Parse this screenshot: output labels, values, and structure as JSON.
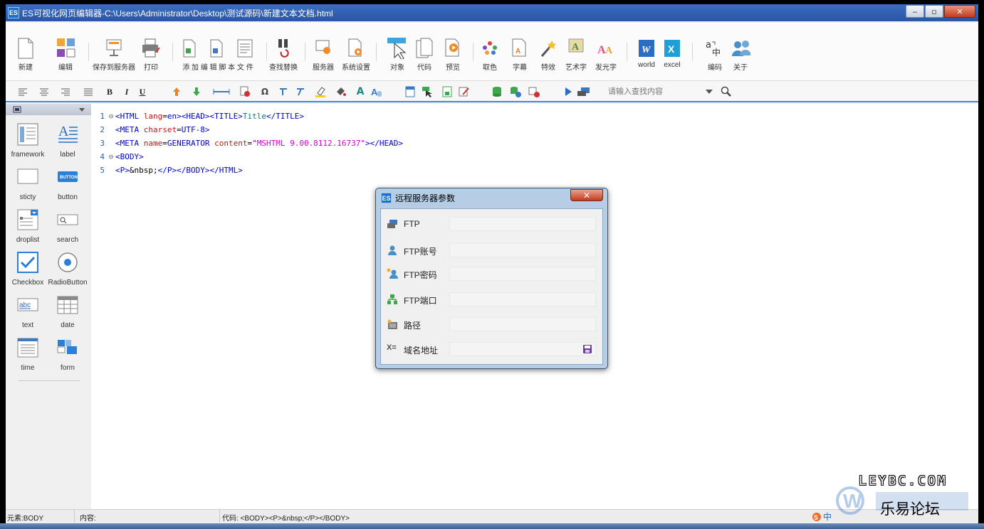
{
  "window": {
    "title": "ES可视化网页编辑器-C:\\Users\\Administrator\\Desktop\\测试源码\\新建文本文档.html",
    "app_badge": "ES",
    "minimize": "‒",
    "maximize": "▫",
    "close": "✕"
  },
  "toolbar": [
    {
      "label": "新建",
      "icon": "new-file-icon"
    },
    {
      "label": "编辑",
      "icon": "edit-icon"
    },
    {
      "label": "保存到服务器",
      "icon": "save-server-icon"
    },
    {
      "label": "打印",
      "icon": "printer-icon"
    },
    {
      "label": "添 加 编 辑 脚 本 文 件",
      "icon": "script-file-icon"
    },
    {
      "label": "查找替换",
      "icon": "find-replace-icon"
    },
    {
      "label": "服务器",
      "icon": "server-icon"
    },
    {
      "label": "系统设置",
      "icon": "settings-icon"
    },
    {
      "label": "对象",
      "icon": "object-cursor-icon"
    },
    {
      "label": "代码",
      "icon": "code-icon"
    },
    {
      "label": "预览",
      "icon": "preview-icon"
    },
    {
      "label": "取色",
      "icon": "color-picker-icon"
    },
    {
      "label": "字幕",
      "icon": "subtitle-icon"
    },
    {
      "label": "特效",
      "icon": "effect-wand-icon"
    },
    {
      "label": "艺术字",
      "icon": "art-text-icon"
    },
    {
      "label": "发光字",
      "icon": "glow-text-icon"
    },
    {
      "label": "world",
      "icon": "word-icon"
    },
    {
      "label": "excel",
      "icon": "excel-icon"
    },
    {
      "label": "编码",
      "icon": "encoding-icon"
    },
    {
      "label": "关于",
      "icon": "about-users-icon"
    }
  ],
  "format_toolbar": {
    "bold": "B",
    "italic": "I",
    "underline": "U",
    "omega": "Ω",
    "text_a": "A",
    "search_placeholder": "请输入查找内容"
  },
  "sidebar": {
    "components": [
      {
        "label": "framework",
        "icon": "framework-icon"
      },
      {
        "label": "label",
        "icon": "label-icon"
      },
      {
        "label": "sticty",
        "icon": "sticty-icon"
      },
      {
        "label": "button",
        "icon": "button-icon",
        "badge": "BUTTON"
      },
      {
        "label": "droplist",
        "icon": "droplist-icon"
      },
      {
        "label": "search",
        "icon": "search-box-icon"
      },
      {
        "label": "Checkbox",
        "icon": "checkbox-icon"
      },
      {
        "label": "RadioButton",
        "icon": "radio-button-icon"
      },
      {
        "label": "text",
        "icon": "text-field-icon",
        "badge": "abc"
      },
      {
        "label": "date",
        "icon": "date-grid-icon"
      },
      {
        "label": "time",
        "icon": "time-icon"
      },
      {
        "label": "form",
        "icon": "form-icon"
      }
    ]
  },
  "editor": {
    "lines": [
      {
        "num": "1",
        "fold": "⊖",
        "tokens": [
          [
            "tag",
            "<HTML "
          ],
          [
            "attr",
            "lang"
          ],
          [
            "plain",
            "="
          ],
          [
            "val",
            "en"
          ],
          [
            "tag",
            "><HEAD><TITLE>"
          ],
          [
            "txt",
            "Title"
          ],
          [
            "tag",
            "</TITLE>"
          ]
        ]
      },
      {
        "num": "2",
        "fold": "",
        "tokens": [
          [
            "tag",
            "<META "
          ],
          [
            "attr",
            "charset"
          ],
          [
            "plain",
            "="
          ],
          [
            "val",
            "UTF-8"
          ],
          [
            "tag",
            ">"
          ]
        ]
      },
      {
        "num": "3",
        "fold": "",
        "tokens": [
          [
            "tag",
            "<META "
          ],
          [
            "attr",
            "name"
          ],
          [
            "plain",
            "="
          ],
          [
            "val",
            "GENERATOR "
          ],
          [
            "attr",
            "content"
          ],
          [
            "plain",
            "="
          ],
          [
            "str",
            "\"MSHTML 9.00.8112.16737\""
          ],
          [
            "tag",
            "></HEAD>"
          ]
        ]
      },
      {
        "num": "4",
        "fold": "⊖",
        "tokens": [
          [
            "tag",
            "<BODY>"
          ]
        ]
      },
      {
        "num": "5",
        "fold": "",
        "tokens": [
          [
            "tag",
            "<P>"
          ],
          [
            "plain",
            "&nbsp;"
          ],
          [
            "tag",
            "</P></BODY></HTML>"
          ]
        ]
      }
    ]
  },
  "dialog": {
    "badge": "ES",
    "title": "远程服务器参数",
    "close": "✕",
    "fields": [
      {
        "label": "FTP",
        "icon": "ftp-server-icon",
        "value": ""
      },
      {
        "label": "FTP账号",
        "icon": "user-icon",
        "value": ""
      },
      {
        "label": "FTP密码",
        "icon": "user-key-icon",
        "value": ""
      },
      {
        "label": "FTP端口",
        "icon": "network-port-icon",
        "value": ""
      },
      {
        "label": "路径",
        "icon": "path-icon",
        "value": ""
      },
      {
        "label": "域名地址",
        "icon": "domain-icon",
        "value": "",
        "prefix": "X="
      }
    ]
  },
  "statusbar": {
    "element": "元素:BODY",
    "content": "内容:",
    "code": "代码:  <BODY><P>&nbsp;</P></BODY>",
    "ime": "中"
  },
  "watermark": {
    "en": "LEYBC.COM",
    "cn": "乐易论坛"
  }
}
